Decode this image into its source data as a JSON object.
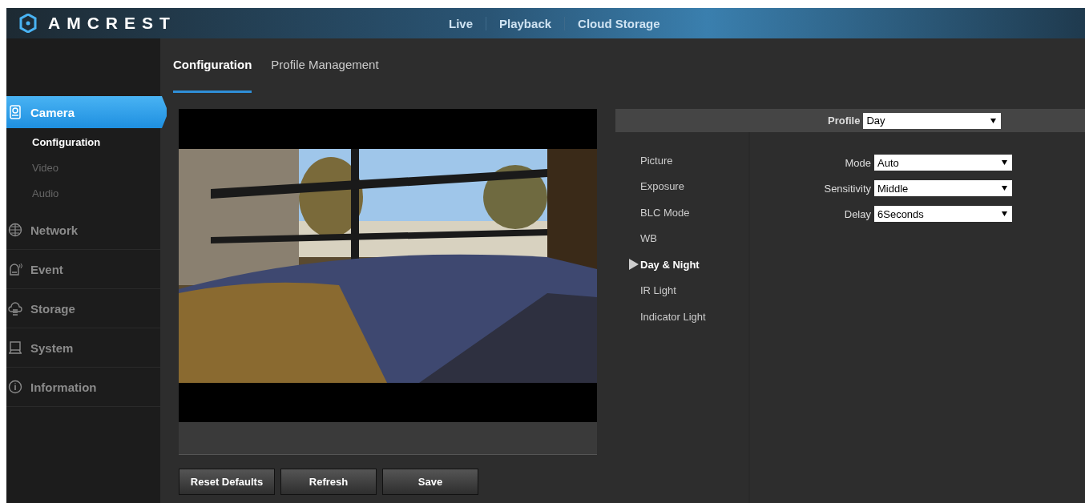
{
  "header": {
    "logo": "AMCREST",
    "nav": [
      {
        "label": "Live",
        "selected": false
      },
      {
        "label": "Playback",
        "selected": false
      },
      {
        "label": "Cloud Storage",
        "selected": false
      }
    ]
  },
  "tabs": [
    {
      "label": "Configuration",
      "selected": true
    },
    {
      "label": "Profile Management",
      "selected": false
    }
  ],
  "sidebar": {
    "items": [
      {
        "label": "Camera",
        "selected": true,
        "children": [
          {
            "label": "Configuration",
            "selected": true
          },
          {
            "label": "Video",
            "selected": false
          },
          {
            "label": "Audio",
            "selected": false
          }
        ]
      },
      {
        "label": "Network",
        "selected": false
      },
      {
        "label": "Event",
        "selected": false
      },
      {
        "label": "Storage",
        "selected": false
      },
      {
        "label": "System",
        "selected": false
      },
      {
        "label": "Information",
        "selected": false
      }
    ]
  },
  "buttons": [
    "Reset Defaults",
    "Refresh",
    "Save"
  ],
  "profile": {
    "label": "Profile",
    "value": "Day"
  },
  "settings_menu": [
    {
      "label": "Picture",
      "selected": false
    },
    {
      "label": "Exposure",
      "selected": false
    },
    {
      "label": "BLC Mode",
      "selected": false
    },
    {
      "label": "WB",
      "selected": false
    },
    {
      "label": "Day & Night",
      "selected": true
    },
    {
      "label": "IR Light",
      "selected": false
    },
    {
      "label": "Indicator Light",
      "selected": false
    }
  ],
  "fields": [
    {
      "label": "Mode",
      "value": "Auto"
    },
    {
      "label": "Sensitivity",
      "value": "Middle"
    },
    {
      "label": "Delay",
      "value": "6Seconds"
    }
  ]
}
